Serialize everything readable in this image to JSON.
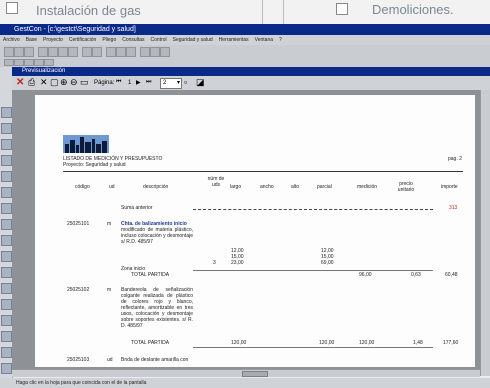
{
  "magazine": {
    "left_item": "Instalación de gas",
    "right_item": "Demoliciones."
  },
  "app": {
    "title": "GestCon - [c:\\gestct\\Seguridad y salud]",
    "menu": [
      "Archivo",
      "Base",
      "Proyecto",
      "Certificación",
      "Pliego",
      "Consultas",
      "Control",
      "Seguridad y salud",
      "Herramientas",
      "Ventana",
      "?"
    ],
    "status": "Haga clic en la hoja para que coincida con el de la pantalla"
  },
  "preview": {
    "title": "Previsualización",
    "page_label": "Página:",
    "page_info": "1",
    "zoom": "2"
  },
  "report": {
    "heading": "LISTADO DE MEDICIÓN Y PRESUPUESTO",
    "project": "Proyecto:  Seguridad y salud",
    "page": "pag.  2",
    "columns": {
      "code": "código",
      "unit": "ud",
      "description": "descripción",
      "num": "núm de uds",
      "length": "largo",
      "width": "ancho",
      "height": "alto",
      "partial": "parcial",
      "measurement": "medición",
      "unit_price": "precio unitario",
      "amount": "importe"
    },
    "previous_sum_label": "Suma anterior",
    "previous_sum_value": "313",
    "items": [
      {
        "code": "25025101",
        "unit": "m",
        "title": "Chta. de balizamiento inicio",
        "description": "modificado de materia plástico, incluso colocación y desmontaje s/ R.D. 485/97",
        "lengths": [
          "12,00",
          "15,00",
          "23,00"
        ],
        "qty": "3",
        "partials": [
          "12,00",
          "15,00",
          "69,00"
        ],
        "zone_label": "Zona inicio",
        "total_label": "TOTAL PARTIDA",
        "measurement": "96,00",
        "unit_price": "0,63",
        "amount": "60,48"
      },
      {
        "code": "25025102",
        "unit": "m",
        "title": "Bandereola de señalización",
        "description": "colgante realizada de plástico de colores rojo y blanco, reflectante, amortizable en tres usos, colocación y desmontaje sobre soportes existentes. s/ R. D. 485/97",
        "length": "120,00",
        "partial": "120,00",
        "total_label": "TOTAL PARTIDA",
        "measurement": "120,00",
        "unit_price": "1,48",
        "amount": "177,60"
      },
      {
        "code": "25025103",
        "unit": "ud",
        "title": "Bnda de deslante amarilla con"
      }
    ]
  },
  "colors": {
    "title_bar": "#0a2a8a",
    "accent_red": "#c0281f"
  }
}
